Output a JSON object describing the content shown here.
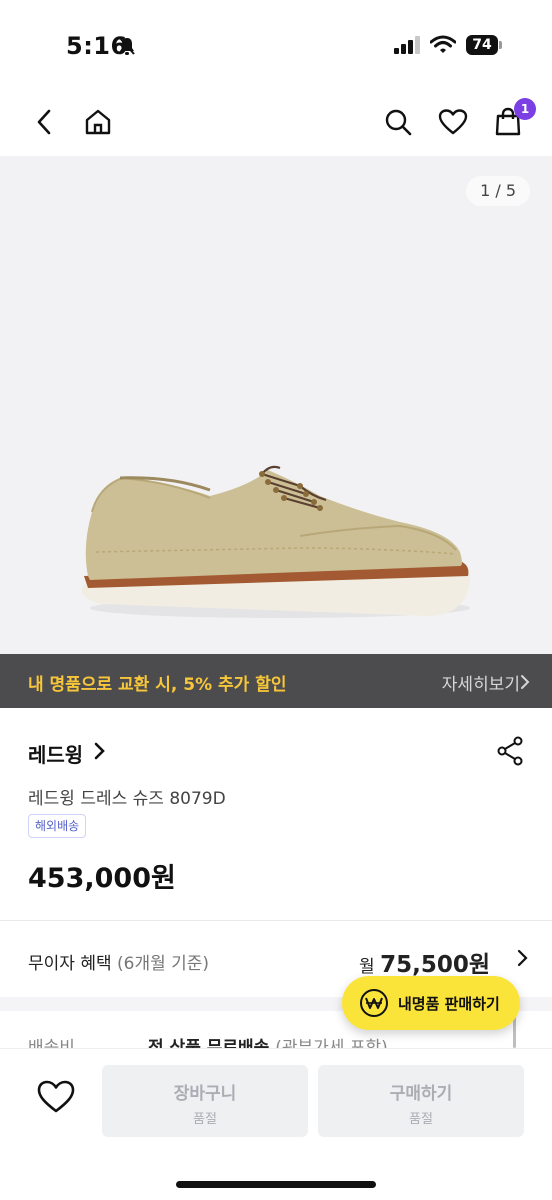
{
  "status": {
    "time": "5:16",
    "battery": "74"
  },
  "nav": {
    "cart_count": "1"
  },
  "gallery": {
    "page_indicator": "1 / 5"
  },
  "promo": {
    "text": "내 명품으로 교환 시, 5% 추가 할인",
    "link_label": "자세히보기"
  },
  "product": {
    "brand": "레드윙",
    "name": "레드윙 드레스 슈즈 8079D",
    "shipping_badge": "해외배송",
    "price": "453,000원"
  },
  "installment": {
    "label": "무이자 혜택",
    "label_sub": "(6개월 기준)",
    "month_prefix": "월",
    "month_amount": "75,500원"
  },
  "shipping": {
    "label": "배송비",
    "value": "전 상품 무료배송",
    "note": "(관부가세 포함)"
  },
  "floating": {
    "sell_label": "내명품 판매하기"
  },
  "bottom_bar": {
    "cart": {
      "label": "장바구니",
      "sub": "품절"
    },
    "buy": {
      "label": "구매하기",
      "sub": "품절"
    }
  },
  "colors": {
    "accent_purple": "#7b3fe4",
    "promo_yellow": "#f7c63a",
    "sell_yellow": "#fbe43a",
    "promo_bg": "#4c4c4e"
  },
  "icons": [
    "bell-off-icon",
    "signal-icon",
    "wifi-icon",
    "battery-icon",
    "back-icon",
    "home-icon",
    "search-icon",
    "heart-icon",
    "cart-icon",
    "chevron-right-icon",
    "share-icon",
    "won-icon"
  ]
}
